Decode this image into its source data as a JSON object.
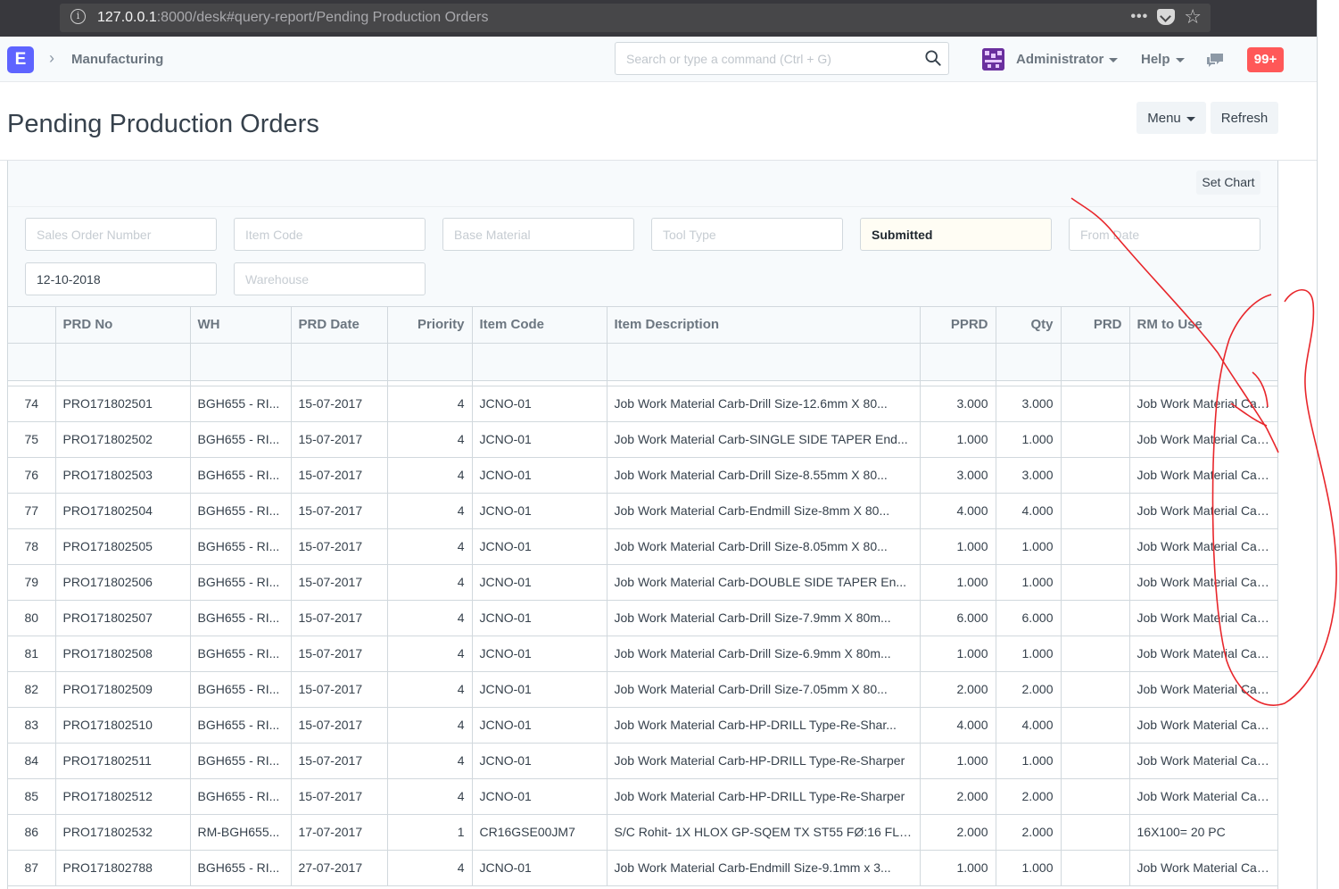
{
  "browser": {
    "url_host": "127.0.0.1",
    "url_path": ":8000/desk#query-report/Pending Production Orders"
  },
  "navbar": {
    "logo_letter": "E",
    "breadcrumb": "Manufacturing",
    "search_placeholder": "Search or type a command (Ctrl + G)",
    "user_label": "Administrator",
    "help_label": "Help",
    "notification_count": "99+"
  },
  "page": {
    "title": "Pending Production Orders",
    "menu_label": "Menu",
    "refresh_label": "Refresh",
    "set_chart_label": "Set Chart"
  },
  "filters": {
    "sales_order_number": "Sales Order Number",
    "item_code": "Item Code",
    "base_material": "Base Material",
    "tool_type": "Tool Type",
    "status_value": "Submitted",
    "from_date": "From Date",
    "to_date_value": "12-10-2018",
    "warehouse": "Warehouse"
  },
  "columns": [
    "PRD No",
    "WH",
    "PRD Date",
    "Priority",
    "Item Code",
    "Item Description",
    "PPRD",
    "Qty",
    "PRD",
    "RM to Use"
  ],
  "rows": [
    {
      "idx": "74",
      "prd_no": "PRO171802501",
      "wh": "BGH655 - RI...",
      "date": "15-07-2017",
      "priority": "4",
      "item_code": "JCNO-01",
      "desc": "Job Work Material Carb-Drill Size-12.6mm X 80...",
      "pprd": "3.000",
      "qty": "3.000",
      "prd": "",
      "rm": "Job Work Material Carb-"
    },
    {
      "idx": "75",
      "prd_no": "PRO171802502",
      "wh": "BGH655 - RI...",
      "date": "15-07-2017",
      "priority": "4",
      "item_code": "JCNO-01",
      "desc": "Job Work Material Carb-SINGLE SIDE TAPER End...",
      "pprd": "1.000",
      "qty": "1.000",
      "prd": "",
      "rm": "Job Work Material Carb-"
    },
    {
      "idx": "76",
      "prd_no": "PRO171802503",
      "wh": "BGH655 - RI...",
      "date": "15-07-2017",
      "priority": "4",
      "item_code": "JCNO-01",
      "desc": "Job Work Material Carb-Drill Size-8.55mm X 80...",
      "pprd": "3.000",
      "qty": "3.000",
      "prd": "",
      "rm": "Job Work Material Carb-"
    },
    {
      "idx": "77",
      "prd_no": "PRO171802504",
      "wh": "BGH655 - RI...",
      "date": "15-07-2017",
      "priority": "4",
      "item_code": "JCNO-01",
      "desc": "Job Work Material Carb-Endmill Size-8mm X 80...",
      "pprd": "4.000",
      "qty": "4.000",
      "prd": "",
      "rm": "Job Work Material Carb-"
    },
    {
      "idx": "78",
      "prd_no": "PRO171802505",
      "wh": "BGH655 - RI...",
      "date": "15-07-2017",
      "priority": "4",
      "item_code": "JCNO-01",
      "desc": "Job Work Material Carb-Drill Size-8.05mm X 80...",
      "pprd": "1.000",
      "qty": "1.000",
      "prd": "",
      "rm": "Job Work Material Carb-"
    },
    {
      "idx": "79",
      "prd_no": "PRO171802506",
      "wh": "BGH655 - RI...",
      "date": "15-07-2017",
      "priority": "4",
      "item_code": "JCNO-01",
      "desc": "Job Work Material Carb-DOUBLE SIDE TAPER En...",
      "pprd": "1.000",
      "qty": "1.000",
      "prd": "",
      "rm": "Job Work Material Carb-"
    },
    {
      "idx": "80",
      "prd_no": "PRO171802507",
      "wh": "BGH655 - RI...",
      "date": "15-07-2017",
      "priority": "4",
      "item_code": "JCNO-01",
      "desc": "Job Work Material Carb-Drill Size-7.9mm X 80m...",
      "pprd": "6.000",
      "qty": "6.000",
      "prd": "",
      "rm": "Job Work Material Carb-"
    },
    {
      "idx": "81",
      "prd_no": "PRO171802508",
      "wh": "BGH655 - RI...",
      "date": "15-07-2017",
      "priority": "4",
      "item_code": "JCNO-01",
      "desc": "Job Work Material Carb-Drill Size-6.9mm X 80m...",
      "pprd": "1.000",
      "qty": "1.000",
      "prd": "",
      "rm": "Job Work Material Carb-"
    },
    {
      "idx": "82",
      "prd_no": "PRO171802509",
      "wh": "BGH655 - RI...",
      "date": "15-07-2017",
      "priority": "4",
      "item_code": "JCNO-01",
      "desc": "Job Work Material Carb-Drill Size-7.05mm X 80...",
      "pprd": "2.000",
      "qty": "2.000",
      "prd": "",
      "rm": "Job Work Material Carb-"
    },
    {
      "idx": "83",
      "prd_no": "PRO171802510",
      "wh": "BGH655 - RI...",
      "date": "15-07-2017",
      "priority": "4",
      "item_code": "JCNO-01",
      "desc": "Job Work Material Carb-HP-DRILL Type-Re-Shar...",
      "pprd": "4.000",
      "qty": "4.000",
      "prd": "",
      "rm": "Job Work Material Carb-"
    },
    {
      "idx": "84",
      "prd_no": "PRO171802511",
      "wh": "BGH655 - RI...",
      "date": "15-07-2017",
      "priority": "4",
      "item_code": "JCNO-01",
      "desc": "Job Work Material Carb-HP-DRILL Type-Re-Sharper",
      "pprd": "1.000",
      "qty": "1.000",
      "prd": "",
      "rm": "Job Work Material Carb-"
    },
    {
      "idx": "85",
      "prd_no": "PRO171802512",
      "wh": "BGH655 - RI...",
      "date": "15-07-2017",
      "priority": "4",
      "item_code": "JCNO-01",
      "desc": "Job Work Material Carb-HP-DRILL Type-Re-Sharper",
      "pprd": "2.000",
      "qty": "2.000",
      "prd": "",
      "rm": "Job Work Material Carb-"
    },
    {
      "idx": "86",
      "prd_no": "PRO171802532",
      "wh": "RM-BGH655...",
      "date": "17-07-2017",
      "priority": "1",
      "item_code": "CR16GSE00JM7",
      "desc": "S/C Rohit- 1X HLOX GP-SQEM TX ST55 FØ:16 FL:...",
      "pprd": "2.000",
      "qty": "2.000",
      "prd": "",
      "rm": "16X100= 20 PC"
    },
    {
      "idx": "87",
      "prd_no": "PRO171802788",
      "wh": "BGH655 - RI...",
      "date": "27-07-2017",
      "priority": "4",
      "item_code": "JCNO-01",
      "desc": "Job Work Material Carb-Endmill Size-9.1mm x 3...",
      "pprd": "1.000",
      "qty": "1.000",
      "prd": "",
      "rm": "Job Work Material Carb-"
    }
  ],
  "colors": {
    "accent": "#5e64ff",
    "notification": "#ff5858",
    "annotation": "#e8262b"
  }
}
